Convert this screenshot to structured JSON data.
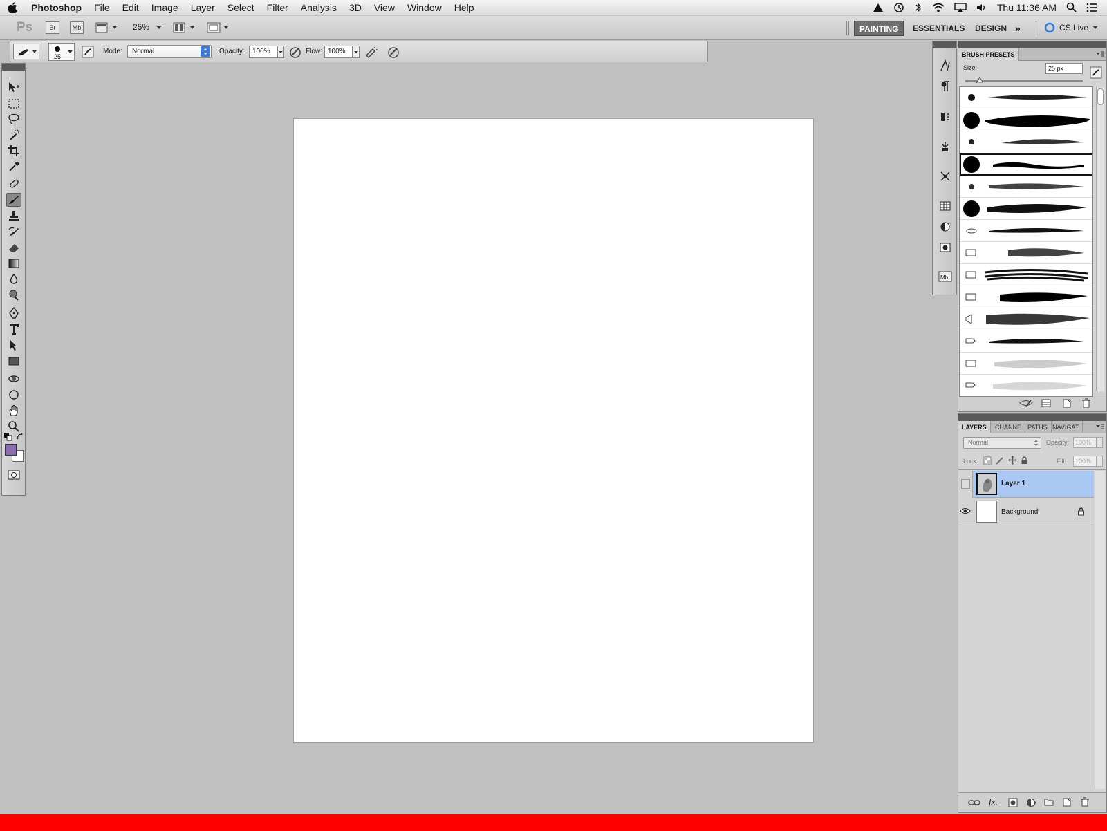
{
  "menubar": {
    "app_name": "Photoshop",
    "items": [
      "File",
      "Edit",
      "Image",
      "Layer",
      "Select",
      "Filter",
      "Analysis",
      "3D",
      "View",
      "Window",
      "Help"
    ],
    "clock": "Thu 11:36 AM"
  },
  "appbar": {
    "logo": "Ps",
    "bridge": "Br",
    "minibridge": "Mb",
    "zoom": "25%",
    "workspaces": [
      "PAINTING",
      "ESSENTIALS",
      "DESIGN"
    ],
    "active_workspace": "PAINTING",
    "more": "»",
    "cslive": "CS Live"
  },
  "options": {
    "brush_size": "25",
    "mode_label": "Mode:",
    "mode_value": "Normal",
    "opacity_label": "Opacity:",
    "opacity_value": "100%",
    "flow_label": "Flow:",
    "flow_value": "100%"
  },
  "colors": {
    "foreground": "#8c6fb0",
    "background": "#ffffff",
    "accent_selected_layer": "#a9c8f4",
    "bottom_bar": "#ff0000"
  },
  "brush_presets": {
    "tab": "BRUSH PRESETS",
    "size_label": "Size:",
    "size_value": "25 px"
  },
  "layers_panel": {
    "tabs": [
      "LAYERS",
      "CHANNE",
      "PATHS",
      "NAVIGAT"
    ],
    "blend_mode": "Normal",
    "opacity_label": "Opacity:",
    "opacity_value": "100%",
    "lock_label": "Lock:",
    "fill_label": "Fill:",
    "fill_value": "100%",
    "layers": [
      {
        "name": "Layer 1",
        "selected": true,
        "visible": false
      },
      {
        "name": "Background",
        "selected": false,
        "visible": true,
        "locked": true
      }
    ]
  }
}
